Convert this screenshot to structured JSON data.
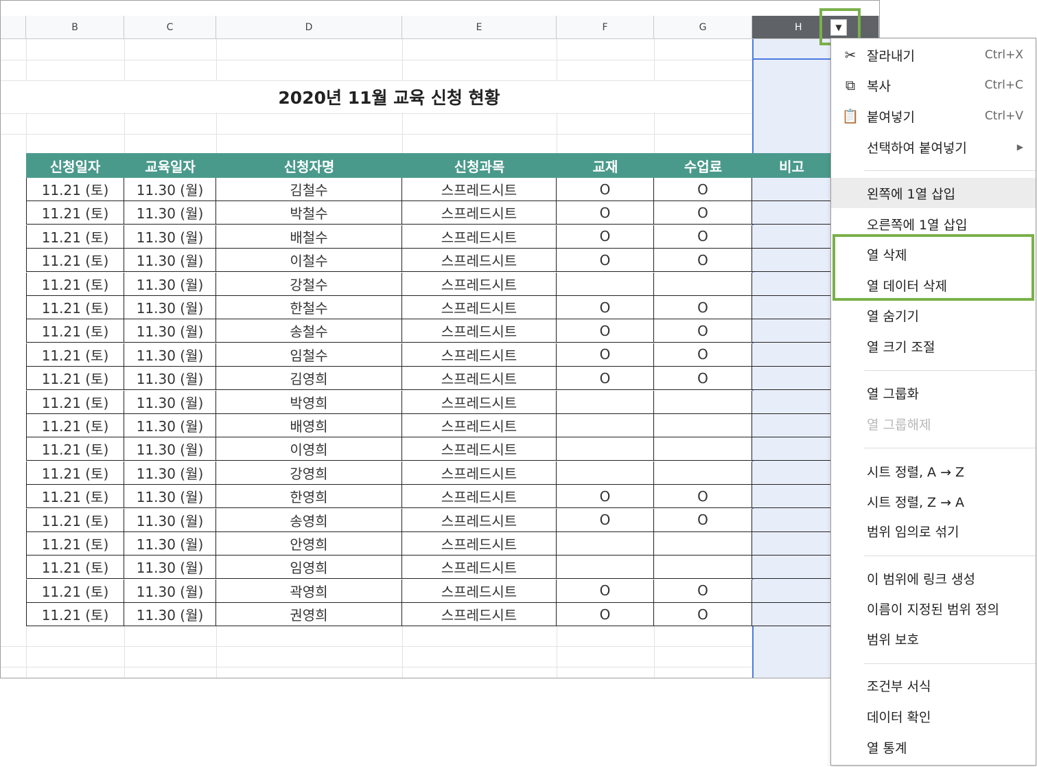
{
  "columns": [
    "B",
    "C",
    "D",
    "E",
    "F",
    "G",
    "H"
  ],
  "title": "2020년 11월 교육 신청 현황",
  "headers": [
    "신청일자",
    "교육일자",
    "신청자명",
    "신청과목",
    "교재",
    "수업료",
    "비고"
  ],
  "rows": [
    [
      "11.21 (토)",
      "11.30 (월)",
      "김철수",
      "스프레드시트",
      "O",
      "O",
      ""
    ],
    [
      "11.21 (토)",
      "11.30 (월)",
      "박철수",
      "스프레드시트",
      "O",
      "O",
      ""
    ],
    [
      "11.21 (토)",
      "11.30 (월)",
      "배철수",
      "스프레드시트",
      "O",
      "O",
      ""
    ],
    [
      "11.21 (토)",
      "11.30 (월)",
      "이철수",
      "스프레드시트",
      "O",
      "O",
      ""
    ],
    [
      "11.21 (토)",
      "11.30 (월)",
      "강철수",
      "스프레드시트",
      "",
      "",
      ""
    ],
    [
      "11.21 (토)",
      "11.30 (월)",
      "한철수",
      "스프레드시트",
      "O",
      "O",
      ""
    ],
    [
      "11.21 (토)",
      "11.30 (월)",
      "송철수",
      "스프레드시트",
      "O",
      "O",
      ""
    ],
    [
      "11.21 (토)",
      "11.30 (월)",
      "임철수",
      "스프레드시트",
      "O",
      "O",
      ""
    ],
    [
      "11.21 (토)",
      "11.30 (월)",
      "김영희",
      "스프레드시트",
      "O",
      "O",
      ""
    ],
    [
      "11.21 (토)",
      "11.30 (월)",
      "박영희",
      "스프레드시트",
      "",
      "",
      ""
    ],
    [
      "11.21 (토)",
      "11.30 (월)",
      "배영희",
      "스프레드시트",
      "",
      "",
      ""
    ],
    [
      "11.21 (토)",
      "11.30 (월)",
      "이영희",
      "스프레드시트",
      "",
      "",
      ""
    ],
    [
      "11.21 (토)",
      "11.30 (월)",
      "강영희",
      "스프레드시트",
      "",
      "",
      ""
    ],
    [
      "11.21 (토)",
      "11.30 (월)",
      "한영희",
      "스프레드시트",
      "O",
      "O",
      ""
    ],
    [
      "11.21 (토)",
      "11.30 (월)",
      "송영희",
      "스프레드시트",
      "O",
      "O",
      ""
    ],
    [
      "11.21 (토)",
      "11.30 (월)",
      "안영희",
      "스프레드시트",
      "",
      "",
      ""
    ],
    [
      "11.21 (토)",
      "11.30 (월)",
      "임영희",
      "스프레드시트",
      "",
      "",
      ""
    ],
    [
      "11.21 (토)",
      "11.30 (월)",
      "곽영희",
      "스프레드시트",
      "O",
      "O",
      ""
    ],
    [
      "11.21 (토)",
      "11.30 (월)",
      "권영희",
      "스프레드시트",
      "O",
      "O",
      ""
    ]
  ],
  "menu": {
    "cut": {
      "label": "잘라내기",
      "shortcut": "Ctrl+X",
      "icon": "scissors-icon"
    },
    "copy": {
      "label": "복사",
      "shortcut": "Ctrl+C",
      "icon": "copy-icon"
    },
    "paste": {
      "label": "붙여넣기",
      "shortcut": "Ctrl+V",
      "icon": "clipboard-icon"
    },
    "paste_special": {
      "label": "선택하여 붙여넣기"
    },
    "insert_left": {
      "label": "왼쪽에 1열 삽입"
    },
    "insert_right": {
      "label": "오른쪽에 1열 삽입"
    },
    "delete_column": {
      "label": "열 삭제"
    },
    "clear_column": {
      "label": "열 데이터 삭제"
    },
    "hide_column": {
      "label": "열 숨기기"
    },
    "resize_column": {
      "label": "열 크기 조절"
    },
    "group_column": {
      "label": "열 그룹화"
    },
    "ungroup_column": {
      "label": "열 그룹해제"
    },
    "sort_az": {
      "label": "시트 정렬, A → Z"
    },
    "sort_za": {
      "label": "시트 정렬, Z → A"
    },
    "randomize": {
      "label": "범위 임의로 섞기"
    },
    "link_range": {
      "label": "이 범위에 링크 생성"
    },
    "named_range": {
      "label": "이름이 지정된 범위 정의"
    },
    "protect_range": {
      "label": "범위 보호"
    },
    "conditional_format": {
      "label": "조건부 서식"
    },
    "data_validation": {
      "label": "데이터 확인"
    },
    "column_stats": {
      "label": "열 통계"
    }
  },
  "colors": {
    "header_bg": "#4a9a8c",
    "highlight": "#7ab04a",
    "selection": "#4a7be0"
  }
}
